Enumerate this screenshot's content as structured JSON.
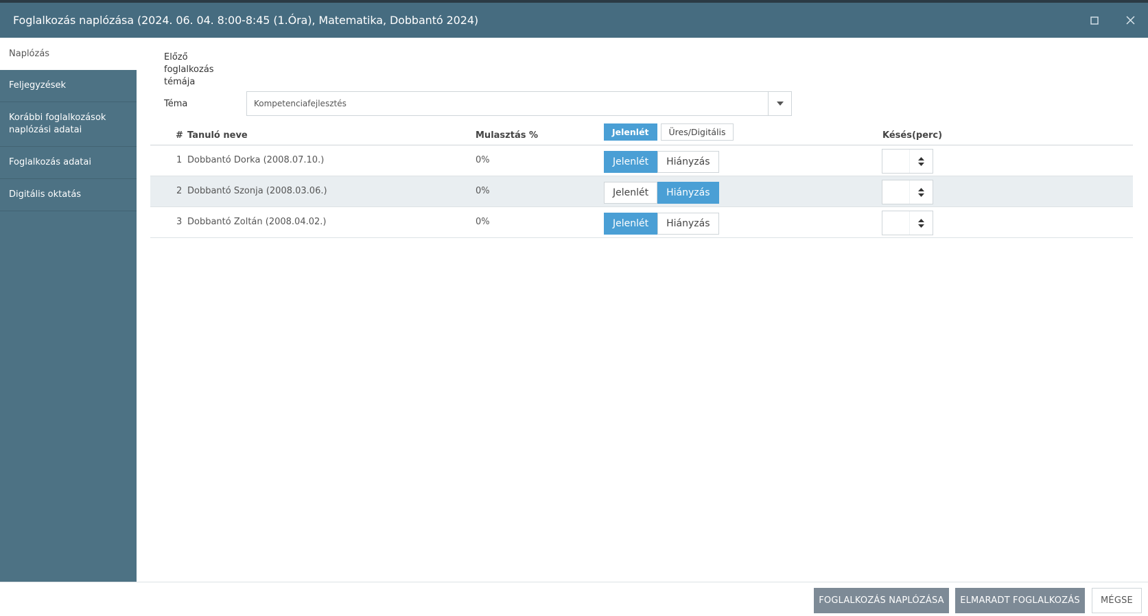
{
  "window": {
    "title": "Foglalkozás naplózása (2024. 06. 04. 8:00-8:45 (1.Óra), Matematika, Dobbantó 2024)",
    "maximize_icon": "maximize-icon",
    "close_icon": "close-icon"
  },
  "sidebar": {
    "items": [
      {
        "label": "Naplózás",
        "active": true
      },
      {
        "label": "Feljegyzések"
      },
      {
        "label": "Korábbi foglalkozások naplózási adatai"
      },
      {
        "label": "Foglalkozás adatai"
      },
      {
        "label": "Digitális oktatás"
      }
    ]
  },
  "form": {
    "previous_topic_label": "Előző foglalkozás témája",
    "topic_label": "Téma",
    "topic_value": "Kompetenciafejlesztés"
  },
  "table": {
    "headers": {
      "hash": "#",
      "name": "Tanuló neve",
      "absence_pct": "Mulasztás %",
      "lateness": "Késés(perc)"
    },
    "header_toggle": {
      "present_label": "Jelenlét",
      "empty_digital_label": "Üres/Digitális",
      "selected": "present"
    },
    "rows": [
      {
        "num": "1",
        "name": "Dobbantó Dorka (2008.07.10.)",
        "absence_pct": "0%",
        "present_label": "Jelenlét",
        "absent_label": "Hiányzás",
        "status": "present",
        "late": ""
      },
      {
        "num": "2",
        "name": "Dobbantó Szonja (2008.03.06.)",
        "absence_pct": "0%",
        "present_label": "Jelenlét",
        "absent_label": "Hiányzás",
        "status": "absent",
        "late": ""
      },
      {
        "num": "3",
        "name": "Dobbantó Zoltán (2008.04.02.)",
        "absence_pct": "0%",
        "present_label": "Jelenlét",
        "absent_label": "Hiányzás",
        "status": "present",
        "late": ""
      }
    ]
  },
  "footer": {
    "log_button": "FOGLALKOZÁS NAPLÓZÁSA",
    "missed_button": "ELMARADT FOGLALKOZÁS",
    "cancel_button": "MÉGSE"
  },
  "colors": {
    "titlebar": "#466c80",
    "sidebar": "#4d7284",
    "accent": "#4a9fd5",
    "footer_button": "#7d8a96"
  }
}
